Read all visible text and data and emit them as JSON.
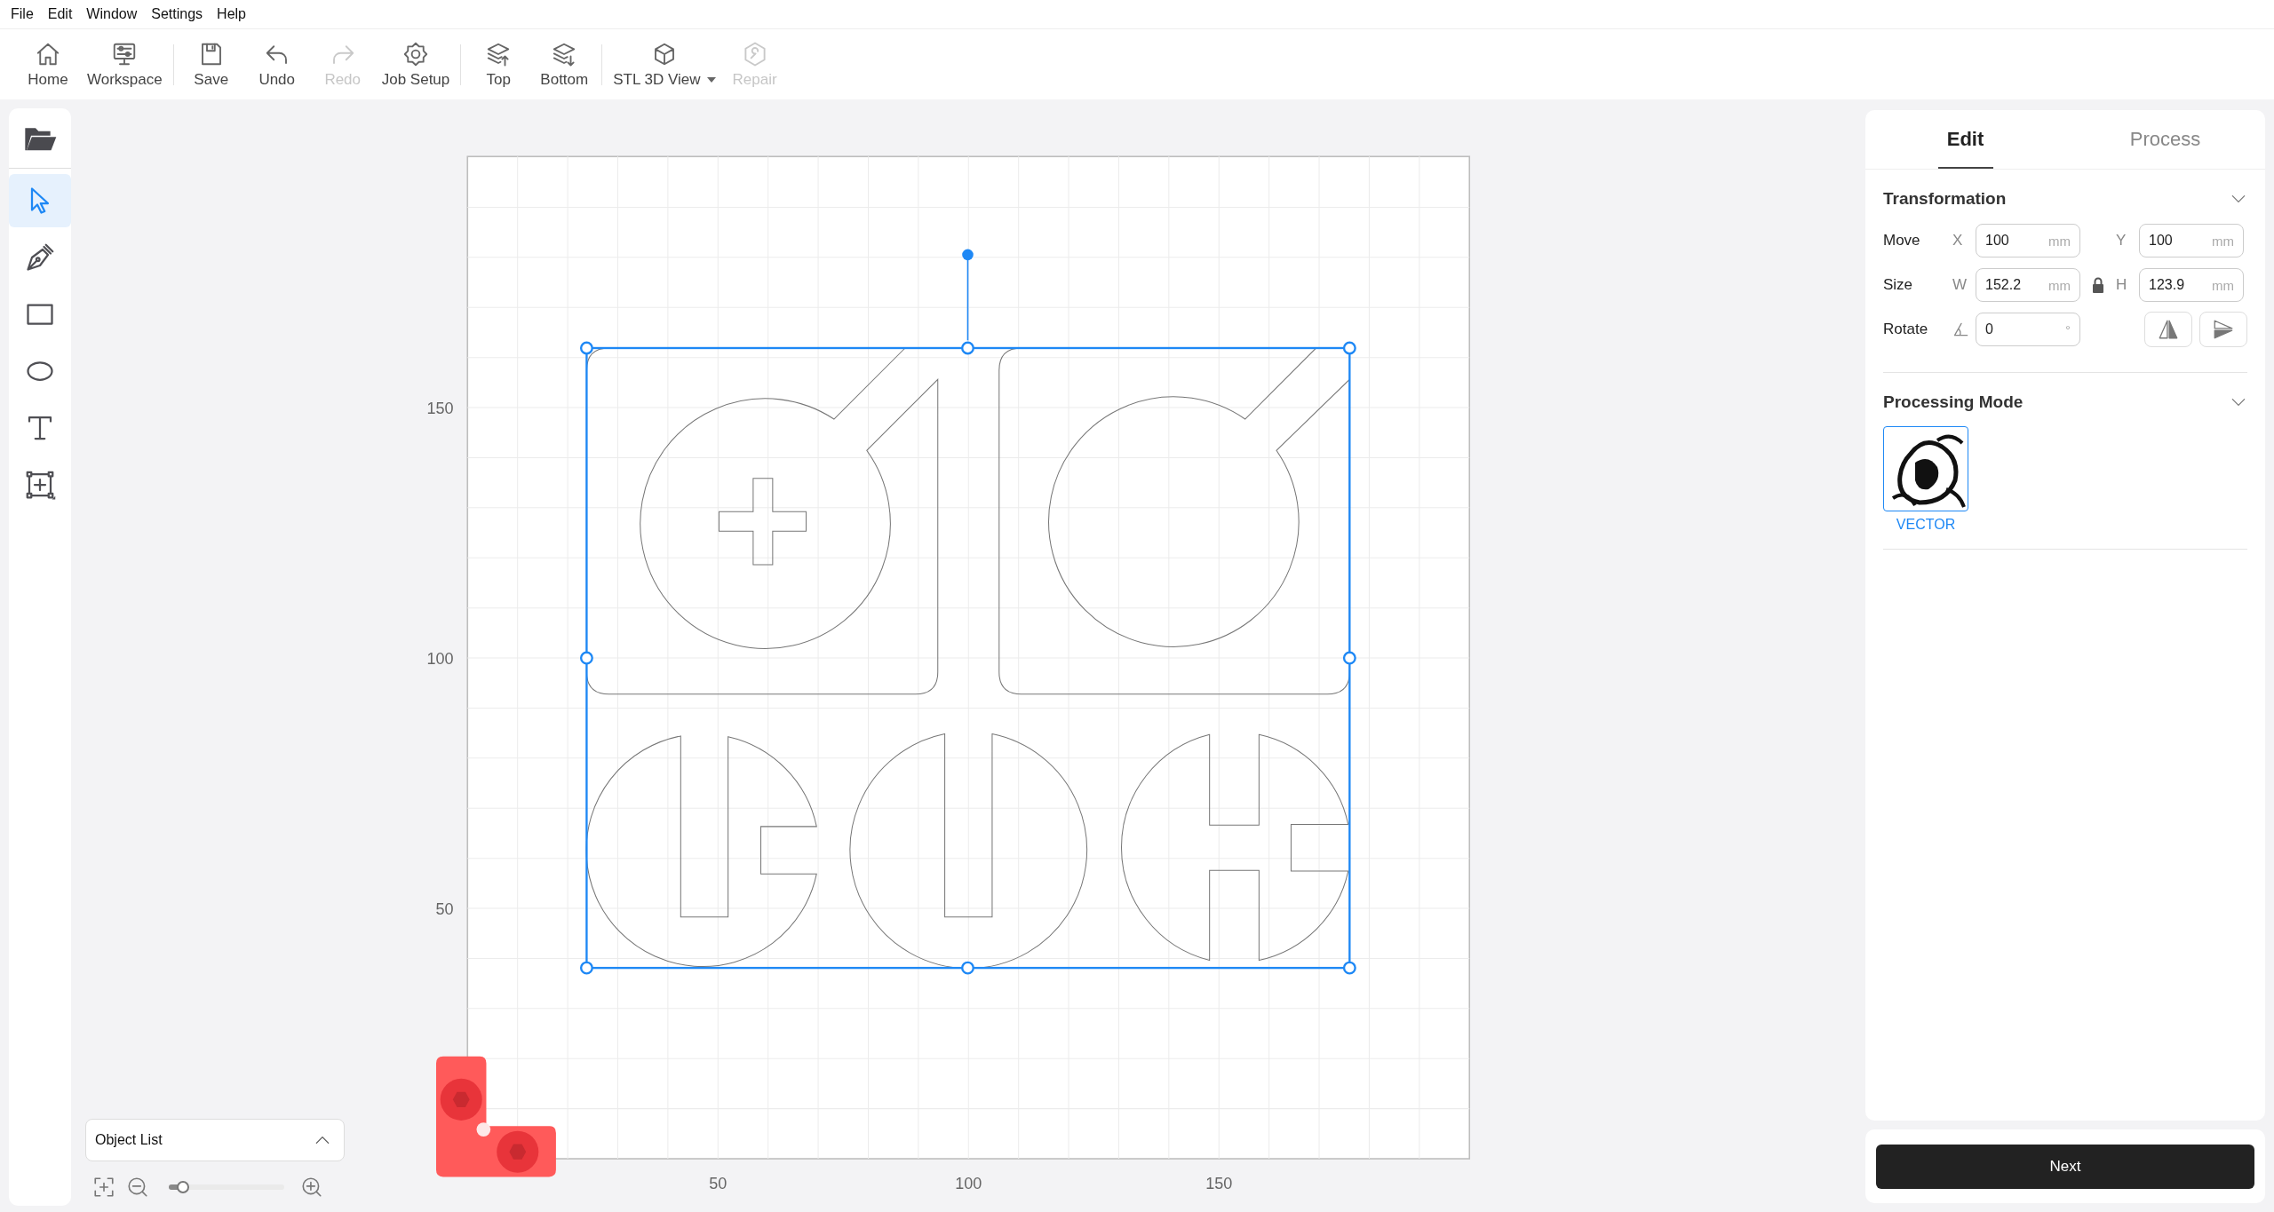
{
  "menu": [
    "File",
    "Edit",
    "Window",
    "Settings",
    "Help"
  ],
  "toolbar_groups": [
    {
      "items": [
        {
          "label": "Home",
          "kind": "button",
          "disabled": false
        },
        {
          "label": "Workspace",
          "kind": "button",
          "disabled": false
        }
      ]
    },
    {
      "items": [
        {
          "label": "Save",
          "kind": "button",
          "disabled": false
        },
        {
          "label": "Undo",
          "kind": "button",
          "disabled": false
        },
        {
          "label": "Redo",
          "kind": "button",
          "disabled": true
        },
        {
          "label": "Job Setup",
          "kind": "button",
          "disabled": false
        }
      ]
    },
    {
      "items": [
        {
          "label": "Top",
          "kind": "button",
          "disabled": false
        },
        {
          "label": "Bottom",
          "kind": "button",
          "disabled": false
        }
      ]
    },
    {
      "items": [
        {
          "label": "STL 3D View",
          "kind": "dropdown",
          "disabled": false
        },
        {
          "label": "Repair",
          "kind": "button",
          "disabled": true
        }
      ]
    }
  ],
  "left_tools": [
    {
      "selected": true
    },
    {
      "selected": false
    },
    {
      "selected": false
    },
    {
      "selected": false
    },
    {
      "selected": false
    },
    {
      "selected": false
    }
  ],
  "canvas": {
    "x_labels": [
      "50",
      "100",
      "150"
    ],
    "y_labels": [
      "150",
      "100",
      "50"
    ]
  },
  "object_list": {
    "title": "Object List"
  },
  "zoom": {
    "level": 0.12
  },
  "panel": {
    "tabs": [
      {
        "label": "Edit",
        "selected": true
      },
      {
        "label": "Process",
        "selected": false
      }
    ],
    "transformation": {
      "title": "Transformation",
      "rows": [
        {
          "label": "Move",
          "kind": "pair",
          "fields": [
            {
              "axis": "X",
              "value": "100",
              "unit": "mm"
            },
            {
              "axis": "Y",
              "value": "100",
              "unit": "mm"
            }
          ]
        },
        {
          "label": "Size",
          "kind": "pair",
          "locked": true,
          "fields": [
            {
              "axis": "W",
              "value": "152.2",
              "unit": "mm"
            },
            {
              "axis": "H",
              "value": "123.9",
              "unit": "mm"
            }
          ]
        },
        {
          "label": "Rotate",
          "kind": "rotate",
          "fields": [
            {
              "value": "0",
              "unit": "°"
            }
          ]
        }
      ]
    },
    "processing": {
      "title": "Processing Mode",
      "modes": [
        {
          "label": "VECTOR",
          "selected": true
        }
      ]
    }
  },
  "next_button": "Next"
}
